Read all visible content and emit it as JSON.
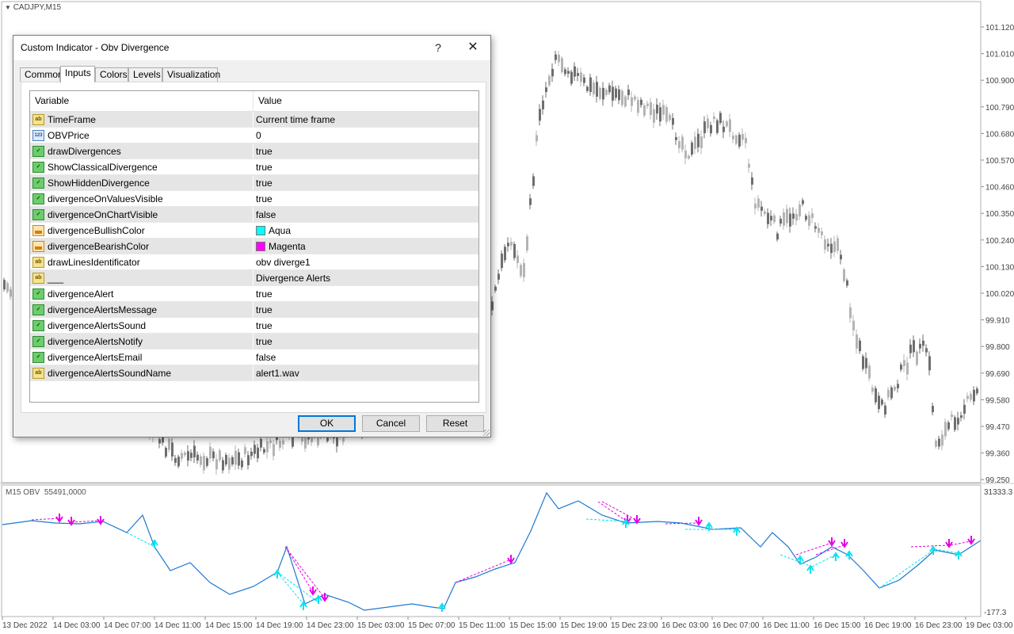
{
  "chart": {
    "symbol_label": "CADJPY,M15",
    "indicator_label": "M15 OBV  55491,0000",
    "price_ticks": [
      "101.120",
      "101.010",
      "100.900",
      "100.790",
      "100.680",
      "100.570",
      "100.460",
      "100.350",
      "100.240",
      "100.130",
      "100.020",
      "99.910",
      "99.800",
      "99.690",
      "99.580",
      "99.470",
      "99.360",
      "99.250"
    ],
    "indicator_ticks": [
      "31333.3",
      "-177.3"
    ],
    "time_labels": [
      "13 Dec 2022",
      "14 Dec 03:00",
      "14 Dec 07:00",
      "14 Dec 11:00",
      "14 Dec 15:00",
      "14 Dec 19:00",
      "14 Dec 23:00",
      "15 Dec 03:00",
      "15 Dec 07:00",
      "15 Dec 11:00",
      "15 Dec 15:00",
      "15 Dec 19:00",
      "15 Dec 23:00",
      "16 Dec 03:00",
      "16 Dec 07:00",
      "16 Dec 11:00",
      "16 Dec 15:00",
      "16 Dec 19:00",
      "16 Dec 23:00",
      "19 Dec 03:00"
    ],
    "colors": {
      "obv_line": "#1e78d2",
      "bullish": "#00e5ee",
      "bearish": "#e600e6",
      "candle_up": "#b4b4b4",
      "candle_down": "#6e6e6e"
    }
  },
  "dialog": {
    "title": "Custom Indicator - Obv Divergence",
    "help_label": "?",
    "close_label": "✕",
    "tabs": [
      {
        "label": "Common"
      },
      {
        "label": "Inputs"
      },
      {
        "label": "Colors"
      },
      {
        "label": "Levels"
      },
      {
        "label": "Visualization"
      }
    ],
    "active_tab": "Inputs",
    "columns": {
      "variable": "Variable",
      "value": "Value"
    },
    "rows": [
      {
        "icon": "ab",
        "name": "TimeFrame",
        "value": "Current time frame"
      },
      {
        "icon": "123",
        "name": "OBVPrice",
        "value": "0"
      },
      {
        "icon": "bool",
        "name": "drawDivergences",
        "value": "true"
      },
      {
        "icon": "bool",
        "name": "ShowClassicalDivergence",
        "value": "true"
      },
      {
        "icon": "bool",
        "name": "ShowHiddenDivergence",
        "value": "true"
      },
      {
        "icon": "bool",
        "name": "divergenceOnValuesVisible",
        "value": "true"
      },
      {
        "icon": "bool",
        "name": "divergenceOnChartVisible",
        "value": "false"
      },
      {
        "icon": "color",
        "name": "divergenceBullishColor",
        "value": "Aqua",
        "swatch": "#00ffff"
      },
      {
        "icon": "color",
        "name": "divergenceBearishColor",
        "value": "Magenta",
        "swatch": "#ff00ff"
      },
      {
        "icon": "ab",
        "name": "drawLinesIdentificator",
        "value": "obv diverge1"
      },
      {
        "icon": "ab",
        "name": "___",
        "value": "Divergence Alerts"
      },
      {
        "icon": "bool",
        "name": "divergenceAlert",
        "value": "true"
      },
      {
        "icon": "bool",
        "name": "divergenceAlertsMessage",
        "value": "true"
      },
      {
        "icon": "bool",
        "name": "divergenceAlertsSound",
        "value": "true"
      },
      {
        "icon": "bool",
        "name": "divergenceAlertsNotify",
        "value": "true"
      },
      {
        "icon": "bool",
        "name": "divergenceAlertsEmail",
        "value": "false"
      },
      {
        "icon": "ab",
        "name": "divergenceAlertsSoundName",
        "value": "alert1.wav"
      }
    ],
    "buttons": {
      "ok": "OK",
      "cancel": "Cancel",
      "reset": "Reset"
    }
  }
}
